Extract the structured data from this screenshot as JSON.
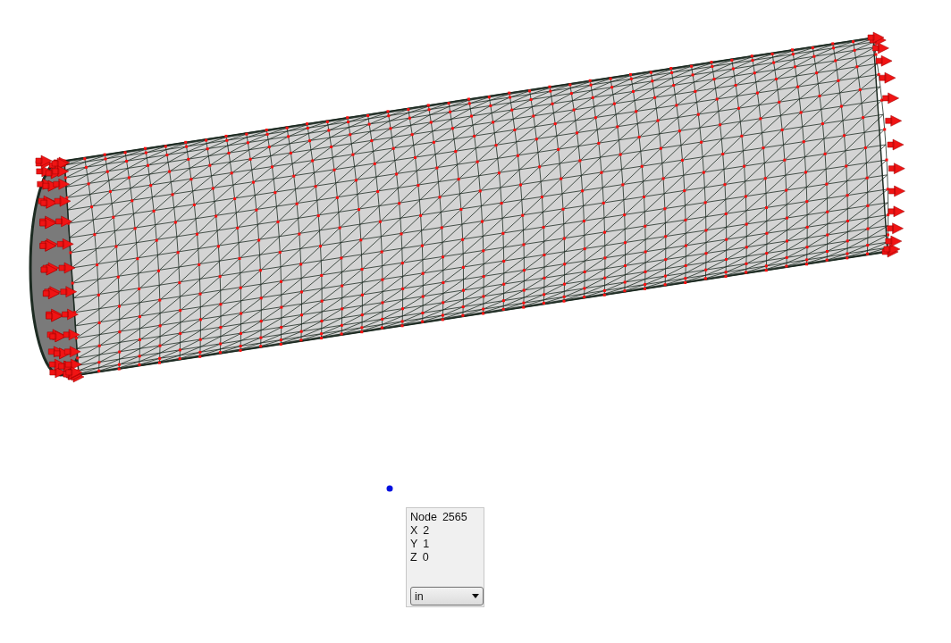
{
  "node_info": {
    "label": "Node",
    "id": "2565",
    "coords": [
      {
        "axis": "X",
        "value": "2"
      },
      {
        "axis": "Y",
        "value": "1"
      },
      {
        "axis": "Z",
        "value": "0"
      }
    ]
  },
  "units_select": {
    "value": "in"
  }
}
